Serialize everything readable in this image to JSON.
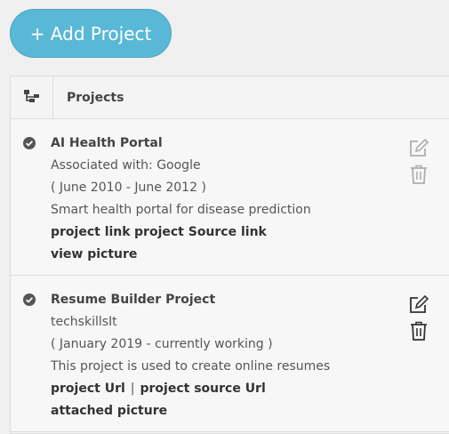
{
  "toolbar": {
    "add_label": "+ Add Project"
  },
  "table": {
    "header_title": "Projects"
  },
  "projects": [
    {
      "title": "AI Health Portal",
      "associated": "Associated with: Google",
      "dates": "( June 2010 - June 2012 )",
      "description": "Smart health portal for disease prediction",
      "link1": "project link",
      "link2": "project Source link",
      "picture": "view picture"
    },
    {
      "title": "Resume Builder Project",
      "associated": "techskillsIt",
      "dates": "( January 2019 - currently working )",
      "description": "This project is used to create online resumes",
      "link1": "project Url",
      "separator": "|",
      "link2": "project source Url",
      "picture": "attached picture"
    }
  ],
  "colors": {
    "add_button": "#59b8d5",
    "panel_bg": "#f7f7f7",
    "page_bg": "#f0f0f0"
  }
}
